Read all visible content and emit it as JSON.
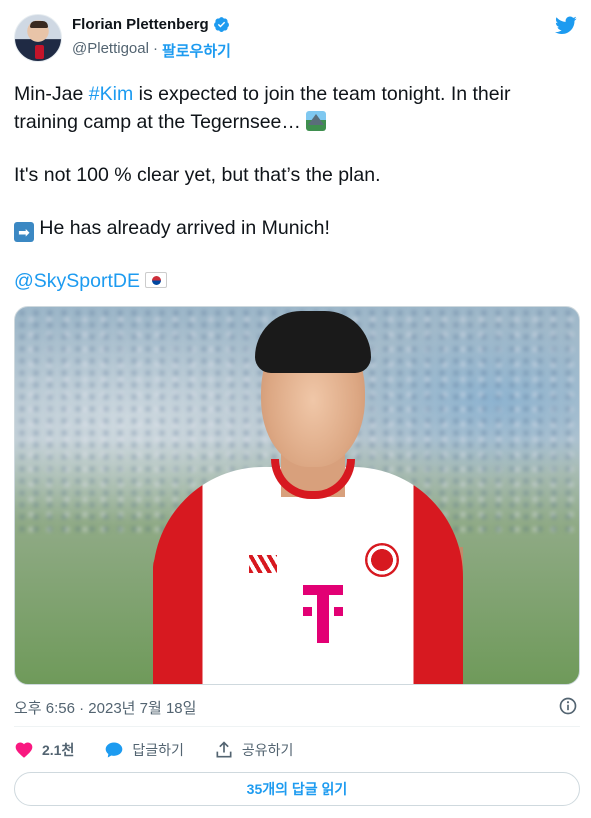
{
  "author": {
    "display_name": "Florian Plettenberg",
    "handle": "@Plettigoal",
    "separator": "·",
    "follow_label": "팔로우하기",
    "verified": true
  },
  "tweet": {
    "line1_prefix": "Min-Jae ",
    "hashtag": "#Kim",
    "line1_suffix": " is expected to join the team tonight. In their training camp at the Tegernsee… ",
    "line2": "It's not 100 % clear yet, but that’s the plan.",
    "arrow_emoji": "➡",
    "line3": " He has already arrived in Munich!",
    "mention": "@SkySportDE",
    "emojis": [
      "mountain-lake-emoji",
      "right-arrow-emoji",
      "south-korea-flag-emoji"
    ]
  },
  "timestamp": "오후 6:56 · 2023년 7월 18일",
  "actions": {
    "like_count": "2.1천",
    "reply_label": "답글하기",
    "share_label": "공유하기"
  },
  "read_replies_label": "35개의 답글 읽기",
  "colors": {
    "accent": "#1d9bf0",
    "like": "#f91880",
    "text": "#0f1419",
    "secondary": "#536471"
  }
}
